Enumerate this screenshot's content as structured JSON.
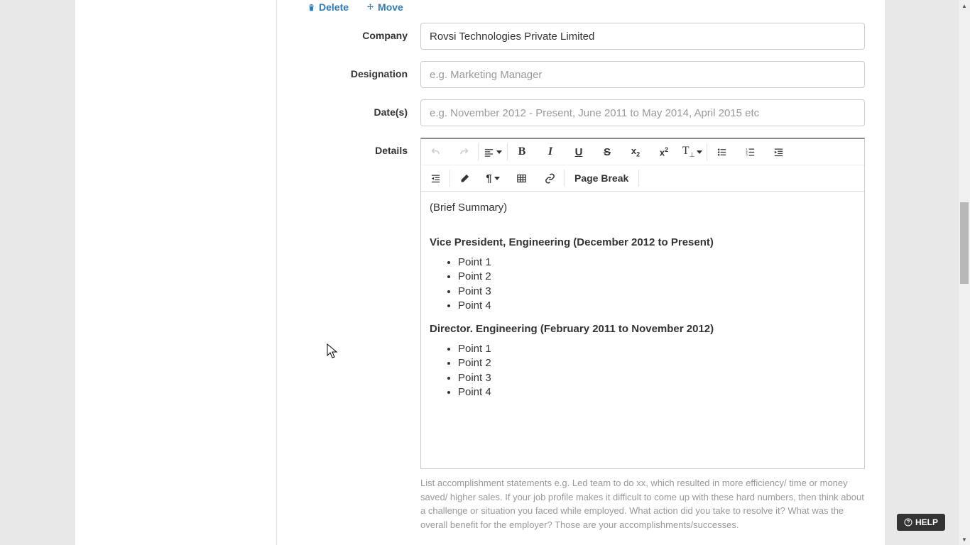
{
  "actions": {
    "delete": "Delete",
    "move": "Move"
  },
  "labels": {
    "company": "Company",
    "designation": "Designation",
    "dates": "Date(s)",
    "details": "Details"
  },
  "fields": {
    "company_value": "Rovsi Technologies Private Limited",
    "designation_value": "",
    "designation_placeholder": "e.g. Marketing Manager",
    "dates_value": "",
    "dates_placeholder": "e.g. November 2012 - Present, June 2011 to May 2014, April 2015 etc"
  },
  "toolbar": {
    "page_break": "Page Break"
  },
  "editor": {
    "summary": "(Brief Summary)",
    "role1": "Vice President, Engineering (December 2012 to Present)",
    "role1_points": [
      "Point 1",
      "Point 2",
      "Point 3",
      "Point 4"
    ],
    "role2": "Director. Engineering (February 2011 to November 2012)",
    "role2_points": [
      "Point 1",
      "Point 2",
      "Point 3",
      "Point 4"
    ]
  },
  "help_text": "List accomplishment statements e.g. Led team to do xx, which resulted in more efficiency/ time or money saved/ higher sales. If your job profile makes it difficult to come up with these hard numbers, then think about a challenge or situation you faced while employed. What action did you take to resolve it? What was the overall benefit for the employer? Those are your accomplishments/successes.",
  "help_button": "HELP"
}
